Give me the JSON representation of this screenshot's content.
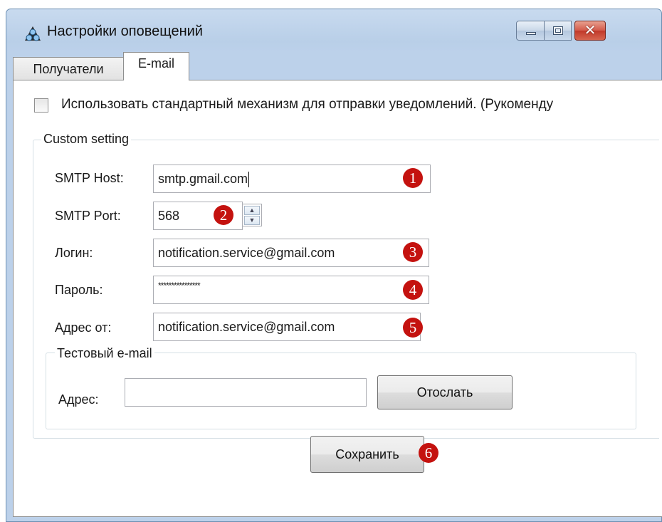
{
  "window": {
    "title": "Настройки оповещений",
    "icons": {
      "app": "bell-cluster-icon",
      "minimize": "minimize-icon",
      "maximize": "maximize-icon",
      "close": "close-icon"
    },
    "close_glyph": "✕",
    "colors": {
      "titlebar": "#bcd1ea",
      "close": "#c1392a",
      "badge": "#c4120f"
    }
  },
  "tabs": [
    {
      "label": "Получатели",
      "active": false
    },
    {
      "label": "E-mail",
      "active": true
    }
  ],
  "email": {
    "use_standard_checkbox": {
      "label": "Использовать стандартный механизм для отправки уведомлений. (Рукоменду",
      "checked": false
    },
    "custom_setting": {
      "legend": "Custom setting",
      "smtp_host": {
        "label": "SMTP Host:",
        "value": "smtp.gmail.com"
      },
      "smtp_port": {
        "label": "SMTP Port:",
        "value": "568"
      },
      "login": {
        "label": "Логин:",
        "value": "notification.service@gmail.com"
      },
      "password": {
        "label": "Пароль:",
        "value": "****************"
      },
      "from_address": {
        "label": "Адрес от:",
        "value": "notification.service@gmail.com"
      }
    },
    "test_email": {
      "legend": "Тестовый e-mail",
      "address_label": "Адрес:",
      "address_value": "",
      "send_button": "Отослать"
    },
    "save_button": "Сохранить"
  },
  "badges": [
    "1",
    "2",
    "3",
    "4",
    "5",
    "6"
  ]
}
